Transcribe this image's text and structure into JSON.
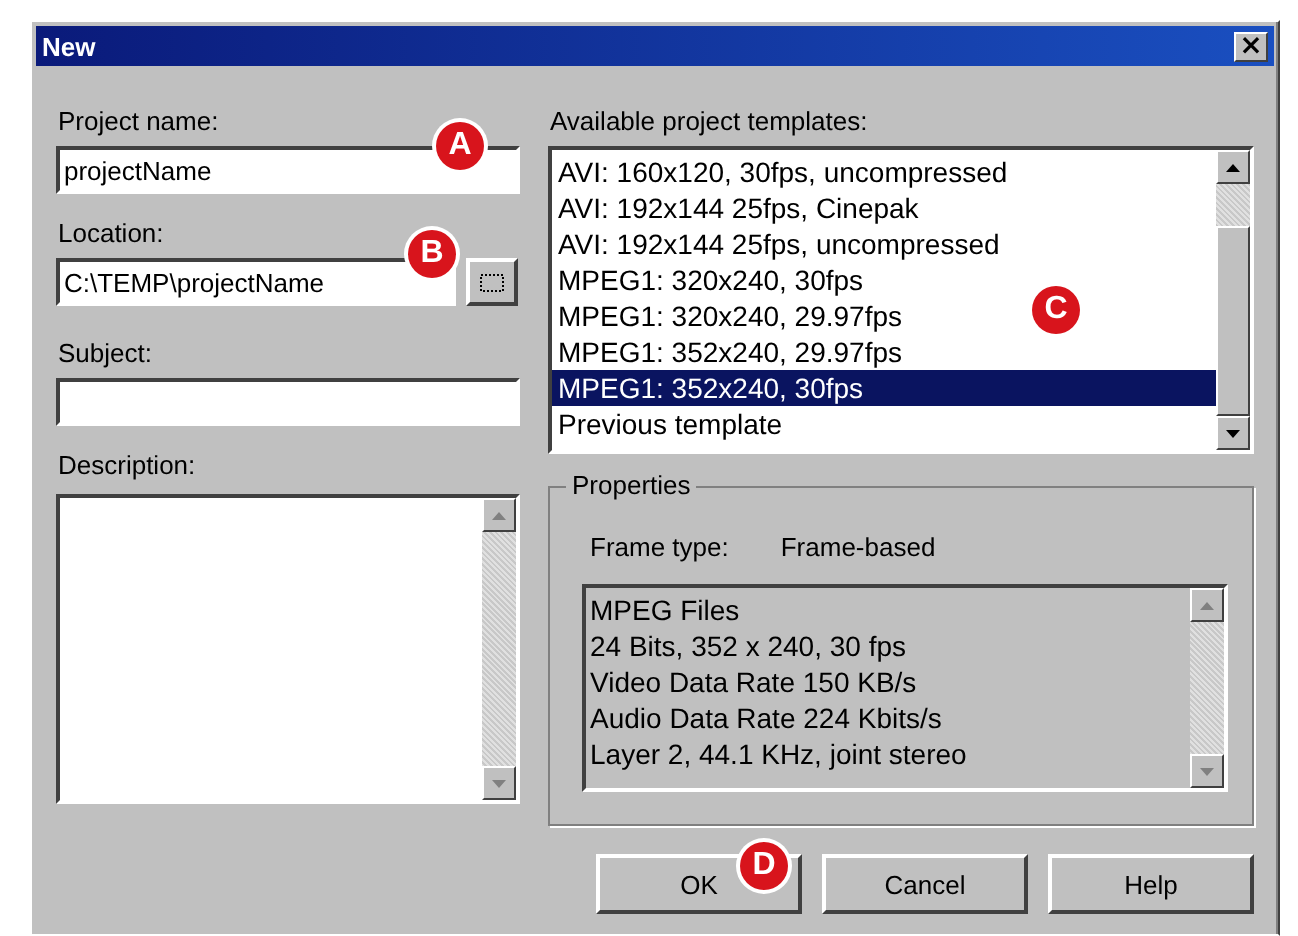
{
  "window": {
    "title": "New",
    "close": "×"
  },
  "project_name": {
    "label": "Project name:",
    "value": "projectName"
  },
  "location": {
    "label": "Location:",
    "value": "C:\\TEMP\\projectName"
  },
  "subject": {
    "label": "Subject:"
  },
  "description": {
    "label": "Description:"
  },
  "templates": {
    "label": "Available project templates:",
    "items": [
      {
        "label": "AVI: 160x120, 30fps, uncompressed",
        "selected": false
      },
      {
        "label": "AVI: 192x144 25fps, Cinepak",
        "selected": false
      },
      {
        "label": "AVI: 192x144 25fps, uncompressed",
        "selected": false
      },
      {
        "label": "MPEG1: 320x240, 30fps",
        "selected": false
      },
      {
        "label": "MPEG1: 320x240, 29.97fps",
        "selected": false
      },
      {
        "label": "MPEG1: 352x240, 29.97fps",
        "selected": false
      },
      {
        "label": "MPEG1: 352x240, 30fps",
        "selected": true
      },
      {
        "label": "Previous template",
        "selected": false
      }
    ]
  },
  "properties": {
    "title": "Properties",
    "frame_type_label": "Frame type:",
    "frame_type": "Frame-based",
    "lines": [
      "MPEG Files",
      "24 Bits, 352 x 240, 30 fps",
      "Video Data Rate 150 KB/s",
      "Audio Data Rate 224 Kbits/s",
      "Layer 2, 44.1 KHz, joint stereo"
    ]
  },
  "buttons": [
    {
      "label": "OK"
    },
    {
      "label": "Cancel"
    },
    {
      "label": "Help"
    }
  ],
  "callouts": [
    {
      "label": "A"
    },
    {
      "label": "B"
    },
    {
      "label": "C"
    },
    {
      "label": "D"
    }
  ]
}
